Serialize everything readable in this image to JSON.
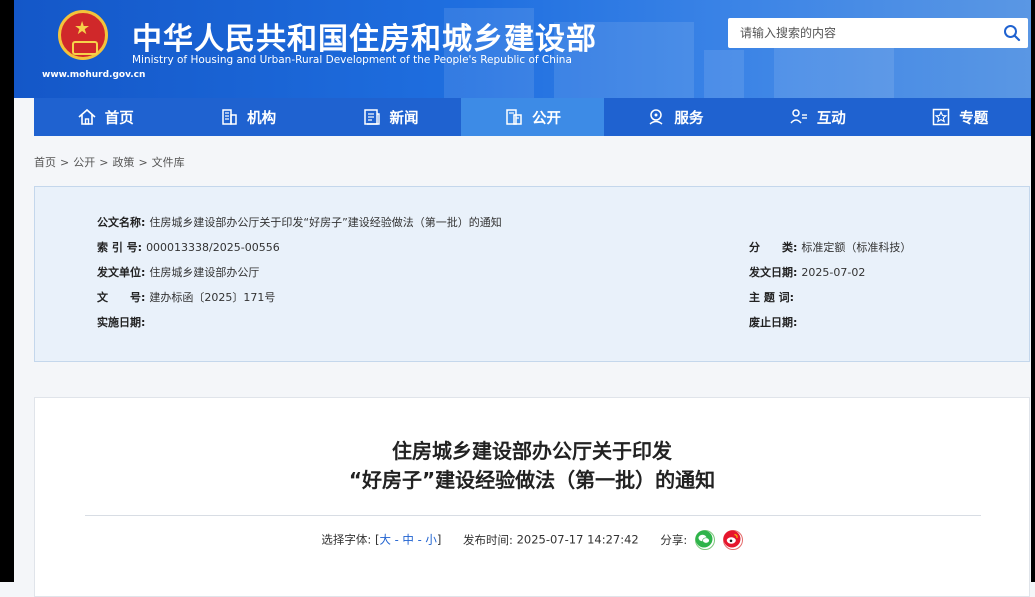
{
  "header": {
    "title": "中华人民共和国住房和城乡建设部",
    "subtitle": "Ministry of Housing and Urban-Rural Development of the People's Republic of China",
    "url": "www.mohurd.gov.cn",
    "search_placeholder": "请输入搜索的内容"
  },
  "nav": {
    "items": [
      {
        "label": "首页",
        "icon": "home-icon"
      },
      {
        "label": "机构",
        "icon": "building-icon"
      },
      {
        "label": "新闻",
        "icon": "news-icon"
      },
      {
        "label": "公开",
        "icon": "document-icon",
        "active": true
      },
      {
        "label": "服务",
        "icon": "service-icon"
      },
      {
        "label": "互动",
        "icon": "interact-icon"
      },
      {
        "label": "专题",
        "icon": "star-icon"
      }
    ]
  },
  "breadcrumb": [
    "首页",
    "公开",
    "政策",
    "文件库"
  ],
  "meta": {
    "doc_name_label": "公文名称:",
    "doc_name": "住房城乡建设部办公厅关于印发“好房子”建设经验做法（第一批）的通知",
    "index_label": "索 引 号:",
    "index": "000013338/2025-00556",
    "category_label": "分　　类:",
    "category": "标准定额（标准科技）",
    "issuer_label": "发文单位:",
    "issuer": "住房城乡建设部办公厅",
    "issue_date_label": "发文日期:",
    "issue_date": "2025-07-02",
    "doc_no_label": "文　　号:",
    "doc_no": "建办标函〔2025〕171号",
    "subject_label": "主 题 词:",
    "subject": "",
    "effective_label": "实施日期:",
    "effective": "",
    "expiry_label": "废止日期:",
    "expiry": ""
  },
  "article": {
    "title_line1": "住房城乡建设部办公厅关于印发",
    "title_line2": "“好房子”建设经验做法（第一批）的通知",
    "font_label": "选择字体:",
    "font_large": "大",
    "font_medium": "中",
    "font_small": "小",
    "publish_label": "发布时间:",
    "publish_time": "2025-07-17 14:27:42",
    "share_label": "分享:"
  }
}
